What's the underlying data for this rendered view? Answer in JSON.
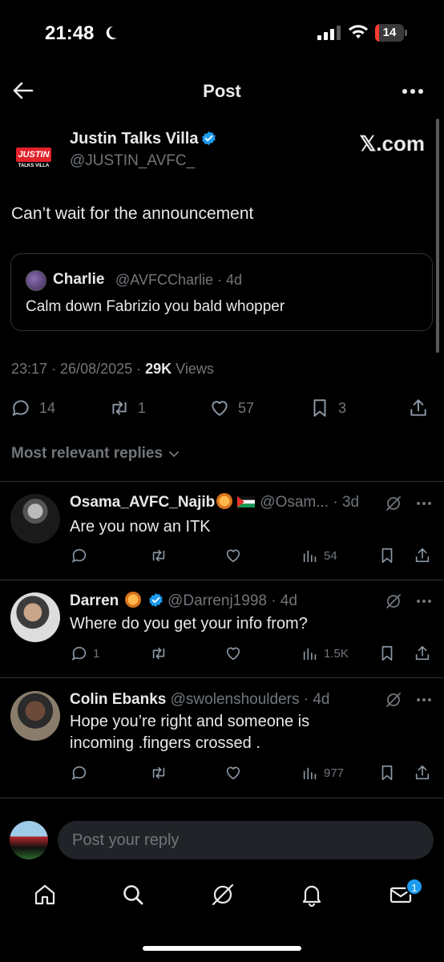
{
  "status_bar": {
    "time": "21:48",
    "battery_level": "14",
    "battery_fraction": 0.14,
    "battery_color": "#ff3b30"
  },
  "header": {
    "title": "Post"
  },
  "post": {
    "author_name": "Justin Talks Villa",
    "author_handle": "@JUSTIN_AVFC_",
    "brand_logo_text": "JUSTIN",
    "brand_logo_sub": "TALKS VILLA",
    "watermark": "𝕏.com",
    "text": "Can’t wait for the announcement",
    "quote": {
      "name": "Charlie",
      "handle": "@AVFCCharlie · 4d",
      "text": "Calm down Fabrizio you bald whopper"
    },
    "timestamp": "23:17 · 26/08/2025 · ",
    "views_count": "29K",
    "views_label": " Views",
    "actions": {
      "replies": "14",
      "reposts": "1",
      "likes": "57",
      "bookmarks": "3"
    }
  },
  "replies_filter": "Most relevant replies",
  "replies": [
    {
      "name": "Osama_AVFC_Najib",
      "handle": "@Osam... · 3d",
      "text": "Are you now an ITK",
      "reply_count": "",
      "views": "54"
    },
    {
      "name": "Darren",
      "handle": "@Darrenj1998 · 4d",
      "text": "Where do you get your info from?",
      "reply_count": "1",
      "views": "1.5K"
    },
    {
      "name": "Colin Ebanks",
      "handle": "@swolenshoulders · 4d",
      "text": "Hope you’re right and someone is incoming .fingers crossed .",
      "reply_count": "",
      "views": "977"
    }
  ],
  "compose": {
    "placeholder": "Post your reply"
  },
  "tabbar": {
    "messages_badge": "1"
  },
  "colors": {
    "background": "#000000",
    "text": "#e7e9ea",
    "muted": "#71767b",
    "accent": "#1d9bf0",
    "border": "#2f3336"
  }
}
